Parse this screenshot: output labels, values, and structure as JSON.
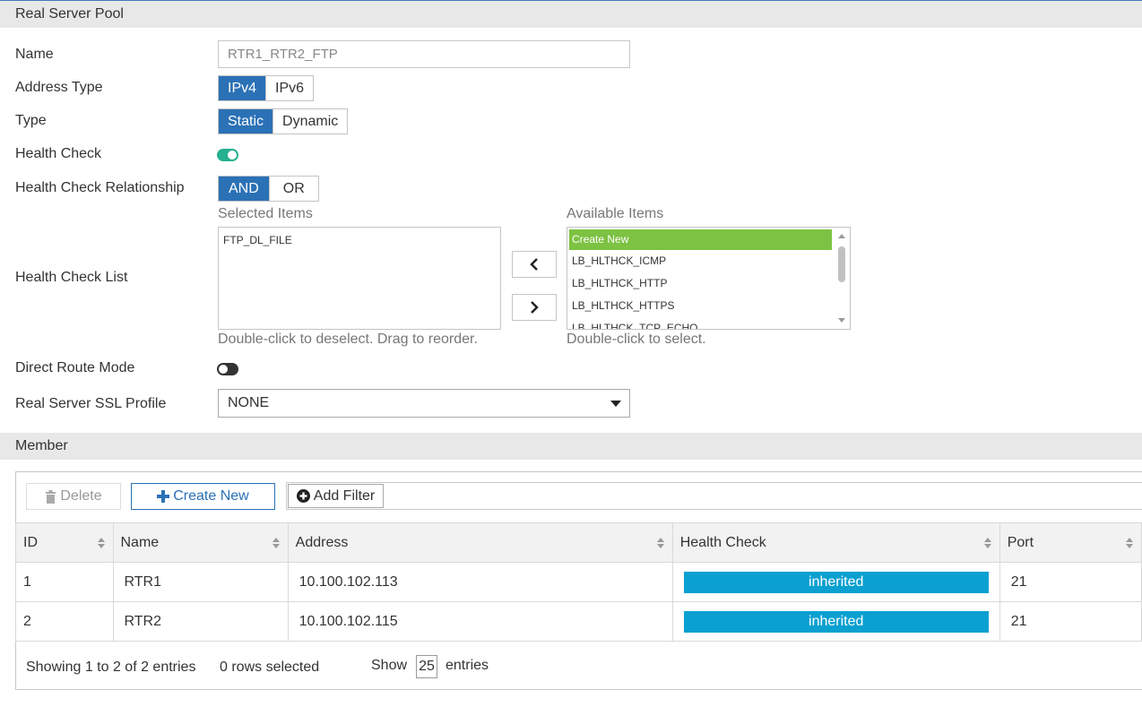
{
  "pool": {
    "section_title": "Real Server Pool",
    "name_label": "Name",
    "name_value": "RTR1_RTR2_FTP",
    "address_type_label": "Address Type",
    "address_type_options": [
      "IPv4",
      "IPv6"
    ],
    "address_type_selected": "IPv4",
    "type_label": "Type",
    "type_options": [
      "Static",
      "Dynamic"
    ],
    "type_selected": "Static",
    "health_check_label": "Health Check",
    "health_check_enabled": true,
    "hc_relationship_label": "Health Check Relationship",
    "hc_relationship_options": [
      "AND",
      "OR"
    ],
    "hc_relationship_selected": "AND",
    "hc_list_label": "Health Check List",
    "selected_items_label": "Selected Items",
    "selected_items": [
      "FTP_DL_FILE"
    ],
    "selected_hint": "Double-click to deselect. Drag to reorder.",
    "available_items_label": "Available Items",
    "available_items": [
      "Create New",
      "LB_HLTHCK_ICMP",
      "LB_HLTHCK_HTTP",
      "LB_HLTHCK_HTTPS",
      "LB_HLTHCK_TCP_ECHO"
    ],
    "available_hint": "Double-click to select.",
    "direct_route_label": "Direct Route Mode",
    "direct_route_enabled": false,
    "ssl_profile_label": "Real Server SSL Profile",
    "ssl_profile_value": "NONE"
  },
  "member": {
    "section_title": "Member",
    "delete_label": "Delete",
    "create_new_label": "Create New",
    "add_filter_label": "Add Filter",
    "columns": [
      "ID",
      "Name",
      "Address",
      "Health Check",
      "Port"
    ],
    "rows": [
      {
        "id": "1",
        "name": "RTR1",
        "address": "10.100.102.113",
        "health_check": "inherited",
        "port": "21"
      },
      {
        "id": "2",
        "name": "RTR2",
        "address": "10.100.102.115",
        "health_check": "inherited",
        "port": "21"
      }
    ],
    "showing_text": "Showing 1 to 2 of 2 entries",
    "rows_selected_text": "0 rows selected",
    "show_label": "Show",
    "show_value": "25",
    "entries_label": "entries"
  },
  "colors": {
    "accent_blue": "#2b71b6",
    "toggle_on": "#25b08f",
    "toggle_off": "#333333",
    "list_highlight": "#7dc242",
    "badge": "#0aa0d0"
  }
}
